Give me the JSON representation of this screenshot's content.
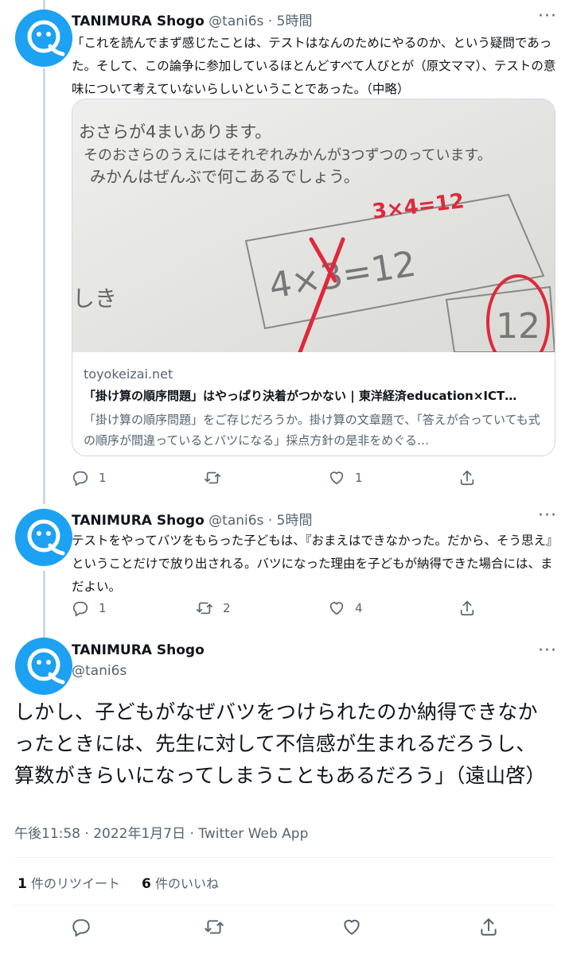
{
  "tweets": [
    {
      "name": "TANIMURA Shogo",
      "handle": "@tani6s",
      "time": "· 5時間",
      "text": "「これを読んでまず感じたことは、テストはなんのためにやるのか、という疑問であった。そして、この論争に参加しているほとんどすべて人びとが（原文ママ）、テストの意味について考えていないらしいということであった。（中略）",
      "card": {
        "image_text": {
          "line1": "おさらが4まいあります。",
          "line2": "そのおさらのうえにはそれぞれみかんが3つずつのっています。",
          "line3": "みかんはぜんぶで何こあるでしょう。",
          "correction": "3×4=12",
          "answer": "4×3=12",
          "side": "しき",
          "circled": "12"
        },
        "domain": "toyokeizai.net",
        "title": "「掛け算の順序問題」はやっぱり決着がつかない | 東洋経済education×ICT…",
        "description": "「掛け算の順序問題」をご存じだろうか。掛け算の文章題で、「答えが合っていても式の順序が間違っているとバツになる」採点方針の是非をめぐる…"
      },
      "replies": "1",
      "retweets": "",
      "likes": "1"
    },
    {
      "name": "TANIMURA Shogo",
      "handle": "@tani6s",
      "time": "· 5時間",
      "text": "テストをやってバツをもらった子どもは、『おまえはできなかった。だから、そう思え』ということだけで放り出される。バツになった理由を子どもが納得できた場合には、まだよい。",
      "replies": "1",
      "retweets": "2",
      "likes": "4"
    }
  ],
  "main_tweet": {
    "name": "TANIMURA Shogo",
    "handle": "@tani6s",
    "text": "しかし、子どもがなぜバツをつけられたのか納得できなかったときには、先生に対して不信感が生まれるだろうし、算数がきらいになってしまうこともあるだろう」（遠山啓）",
    "timestamp": "午後11:58 · 2022年1月7日 · Twitter Web App",
    "retweet_count": "1",
    "retweet_label": "件のリツイート",
    "like_count": "6",
    "like_label": "件のいいね"
  },
  "icons": {
    "more": "more-horizontal-icon",
    "reply": "reply-icon",
    "retweet": "retweet-icon",
    "like": "heart-icon",
    "share": "share-icon",
    "avatar": "q-logo-avatar"
  },
  "colors": {
    "avatar": "#1da1f2",
    "text": "#0f1419",
    "muted": "#536471",
    "border": "#cfd9de",
    "red_ink": "#e0283c"
  }
}
